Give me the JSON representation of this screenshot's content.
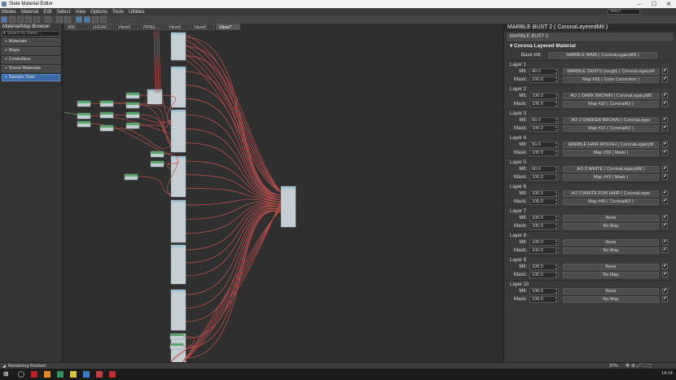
{
  "window": {
    "title": "Slate Material Editor",
    "buttons": [
      "–",
      "☐",
      "✕"
    ]
  },
  "menu": {
    "items": [
      "Modes",
      "Material",
      "Edit",
      "Select",
      "View",
      "Options",
      "Tools",
      "Utilities"
    ],
    "view_select": "View7"
  },
  "left_panel": {
    "title": "Material/Map Browser",
    "search_placeholder": "Search by Name ...",
    "sections": [
      {
        "label": "+ Materials",
        "selected": false
      },
      {
        "label": "+ Maps",
        "selected": false
      },
      {
        "label": "+ Controllers",
        "selected": false
      },
      {
        "label": "+ Scene Materials",
        "selected": false
      },
      {
        "label": "+ Sample Slots",
        "selected": true
      }
    ]
  },
  "view_tabs": [
    "000",
    "GIGAF...",
    "View3",
    "PIPEL...",
    "View5",
    "View6",
    "View7"
  ],
  "active_view_tab": "View7",
  "right_panel": {
    "header": "MARBLE BUST 2  ( CoronaLayeredMtl )",
    "name_field": "MARBLE BUST 2",
    "rollout_title": "Corona Layered Material",
    "base_mtl_label": "Base mtl:",
    "base_mtl_value": "MARBLE MAIN  ( CoronaLegacyMtl )",
    "mtl_label": "Mtl:",
    "mask_label": "Mask:",
    "layers": [
      {
        "title": "Layer 1",
        "amount": "40.0",
        "mtl": "MARBLE DENTS (rough)  ( CoronaLegacyM",
        "mask_amount": "100.0",
        "mask": "Map #35  ( Color Correction )"
      },
      {
        "title": "Layer 2",
        "amount": "100.0",
        "mtl": "AO 1 DARK BROWN  ( CoronaLegacyMtl",
        "mask_amount": "100.0",
        "mask": "Map #32  ( CoronaAO )"
      },
      {
        "title": "Layer 3",
        "amount": "60.0",
        "mtl": "AO 2 DARKER BROWN  ( CoronaLegac",
        "mask_amount": "100.0",
        "mask": "Map #31  ( CoronaAO )"
      },
      {
        "title": "Layer 4",
        "amount": "50.0",
        "mtl": "MARBLE HAIR ROUGH  ( CoronaLegacyM",
        "mask_amount": "100.0",
        "mask": "Map #39  ( Mask )"
      },
      {
        "title": "Layer 5",
        "amount": "60.0",
        "mtl": "AO 3 WHITE  ( CoronaLegacyMtl )",
        "mask_amount": "100.0",
        "mask": "Map #43  ( Mask )"
      },
      {
        "title": "Layer 6",
        "amount": "100.0",
        "mtl": "AO 3 WHITE FOR HAIR  ( CoronaLegac",
        "mask_amount": "100.0",
        "mask": "Map #45  ( CoronaAO )"
      },
      {
        "title": "Layer 7",
        "amount": "100.0",
        "mtl": "None",
        "mask_amount": "100.0",
        "mask": "No Map"
      },
      {
        "title": "Layer 8",
        "amount": "100.0",
        "mtl": "None",
        "mask_amount": "100.0",
        "mask": "No Map"
      },
      {
        "title": "Layer 9",
        "amount": "100.0",
        "mtl": "None",
        "mask_amount": "100.0",
        "mask": "No Map"
      },
      {
        "title": "Layer 10",
        "amount": "100.0",
        "mtl": "None",
        "mask_amount": "100.0",
        "mask": "No Map"
      }
    ]
  },
  "status": {
    "text": "Rendering finished",
    "zoom": "37%"
  },
  "taskbar": {
    "clock": "14:14"
  },
  "colors": {
    "wire": "#c0504d",
    "node_header": "#9fc5d4",
    "node_green": "#59a96a",
    "accent": "#3a6aa8"
  }
}
